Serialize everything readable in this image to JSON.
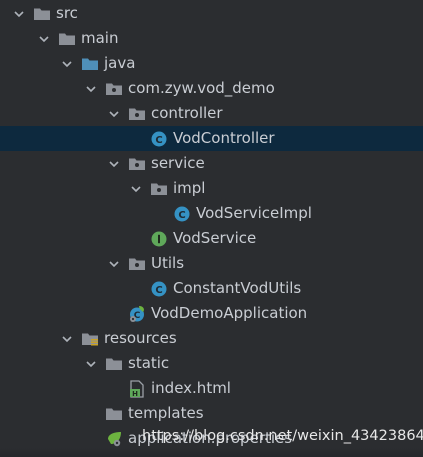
{
  "colors": {
    "background": "#2b2d30",
    "selected_row": "#0d293e",
    "text": "#c9cdd3",
    "folder_gray": "#8c9097",
    "source_folder_blue": "#4f8fb8",
    "class_icon": "#3592c4",
    "interface_icon": "#5fa85a",
    "spring_leaf": "#6db33f"
  },
  "tree": {
    "items": [
      {
        "label": "src",
        "icon": "folder-icon",
        "expanded": true
      },
      {
        "label": "main",
        "icon": "folder-icon",
        "expanded": true
      },
      {
        "label": "java",
        "icon": "source-folder-icon",
        "expanded": true
      },
      {
        "label": "com.zyw.vod_demo",
        "icon": "package-icon",
        "expanded": true
      },
      {
        "label": "controller",
        "icon": "package-icon",
        "expanded": true
      },
      {
        "label": "VodController",
        "icon": "class-icon",
        "selected": true
      },
      {
        "label": "service",
        "icon": "package-icon",
        "expanded": true
      },
      {
        "label": "impl",
        "icon": "package-icon",
        "expanded": true
      },
      {
        "label": "VodServiceImpl",
        "icon": "class-icon"
      },
      {
        "label": "VodService",
        "icon": "interface-icon"
      },
      {
        "label": "Utils",
        "icon": "package-icon",
        "expanded": true
      },
      {
        "label": "ConstantVodUtils",
        "icon": "class-icon"
      },
      {
        "label": "VodDemoApplication",
        "icon": "spring-boot-class-icon"
      },
      {
        "label": "resources",
        "icon": "resources-folder-icon",
        "expanded": true
      },
      {
        "label": "static",
        "icon": "folder-icon",
        "expanded": true
      },
      {
        "label": "index.html",
        "icon": "html-file-icon"
      },
      {
        "label": "templates",
        "icon": "folder-icon"
      },
      {
        "label": "application.properties",
        "icon": "properties-file-icon"
      }
    ]
  },
  "watermark": {
    "text": "https://blog.csdn.net/weixin_43423864"
  }
}
